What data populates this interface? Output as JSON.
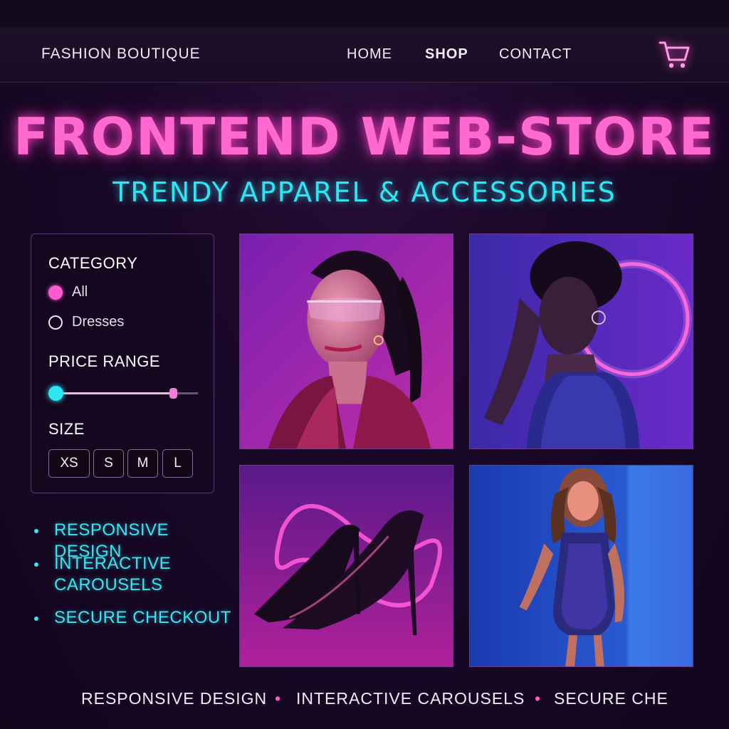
{
  "navbar": {
    "brand": "FASHION BOUTIQUE",
    "links": [
      "HOME",
      "SHOP",
      "CONTACT"
    ],
    "cart_icon": "shopping-cart-icon"
  },
  "hero": {
    "title": "FRONTEND WEB-STORE",
    "subtitle": "TRENDY APPAREL & ACCESSORIES"
  },
  "filters": {
    "category_heading": "CATEGORY",
    "category_options": [
      {
        "label": "All",
        "selected": true
      },
      {
        "label": "Dresses",
        "selected": false
      }
    ],
    "price_heading": "PRICE RANGE",
    "price_range_fraction": [
      0.0,
      0.84
    ],
    "size_heading": "SIZE",
    "sizes": [
      "XS",
      "S",
      "M",
      "L"
    ]
  },
  "features": [
    "RESPONSIVE DESIGN",
    "INTERACTIVE CAROUSELS",
    "SECURE CHECKOUT"
  ],
  "footer": {
    "items": [
      "RESPONSIVE DESIGN",
      "INTERACTIVE CAROUSELS",
      "SECURE CHE"
    ],
    "separator": "•"
  },
  "colors": {
    "accent_pink": "#ff6ad0",
    "accent_cyan": "#2ee6f2",
    "background": "#1a0828"
  }
}
